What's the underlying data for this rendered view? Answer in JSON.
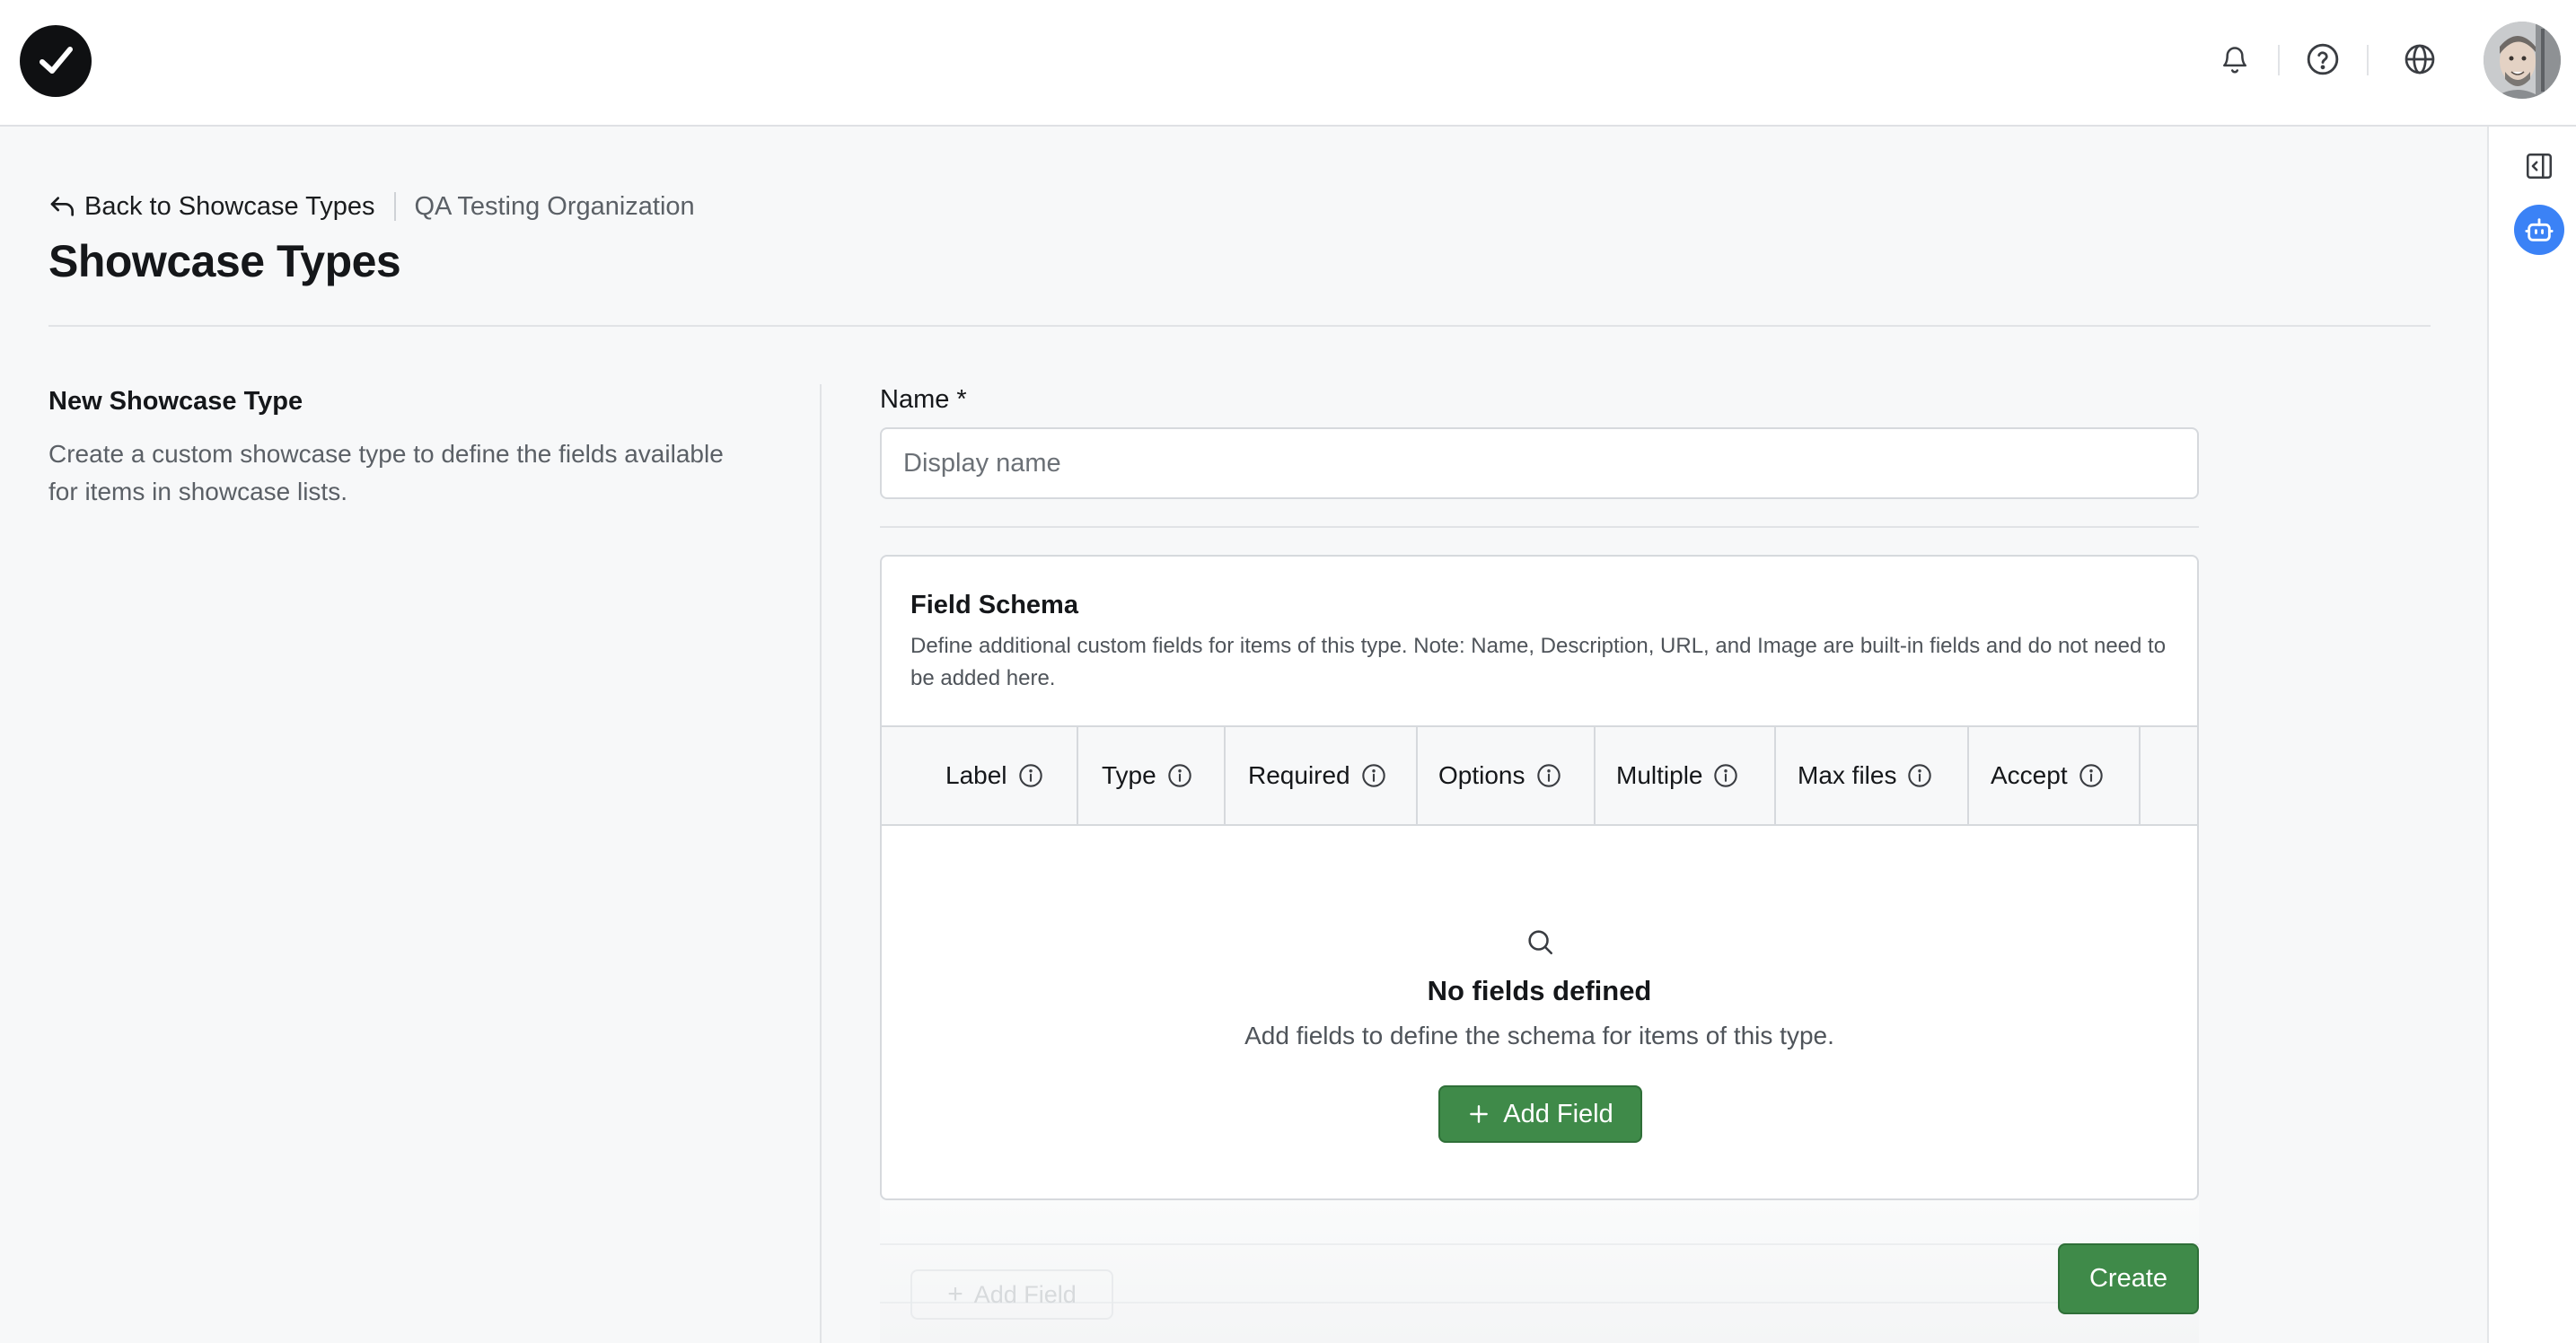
{
  "topbar": {
    "logo_icon": "checkmark-logo-icon",
    "icons": [
      "bell-icon",
      "help-circle-icon",
      "globe-icon"
    ],
    "avatar_icon": "user-avatar"
  },
  "rail": {
    "icons": [
      "panel-toggle-icon",
      "bot-assistant-icon"
    ],
    "bot_color": "#3b82f6"
  },
  "header": {
    "back_label": "Back to Showcase Types",
    "org_name": "QA Testing Organization",
    "title": "Showcase Types"
  },
  "intro": {
    "heading": "New Showcase Type",
    "description": "Create a custom showcase type to define the fields available for items in showcase lists."
  },
  "form": {
    "name_label": "Name *",
    "name_placeholder": "Display name",
    "name_value": ""
  },
  "schema": {
    "title": "Field Schema",
    "description": "Define additional custom fields for items of this type. Note: Name, Description, URL, and Image are built-in fields and do not need to be added here.",
    "columns": [
      "Label",
      "Type",
      "Required",
      "Options",
      "Multiple",
      "Max files",
      "Accept"
    ],
    "empty_title": "No fields defined",
    "empty_description": "Add fields to define the schema for items of this type.",
    "add_field_label": "Add Field"
  },
  "footer": {
    "ghost_add_field_label": "Add Field",
    "create_label": "Create"
  },
  "colors": {
    "primary_green": "#3f8a49",
    "text_primary": "#15171a",
    "text_secondary": "#5b6066"
  }
}
